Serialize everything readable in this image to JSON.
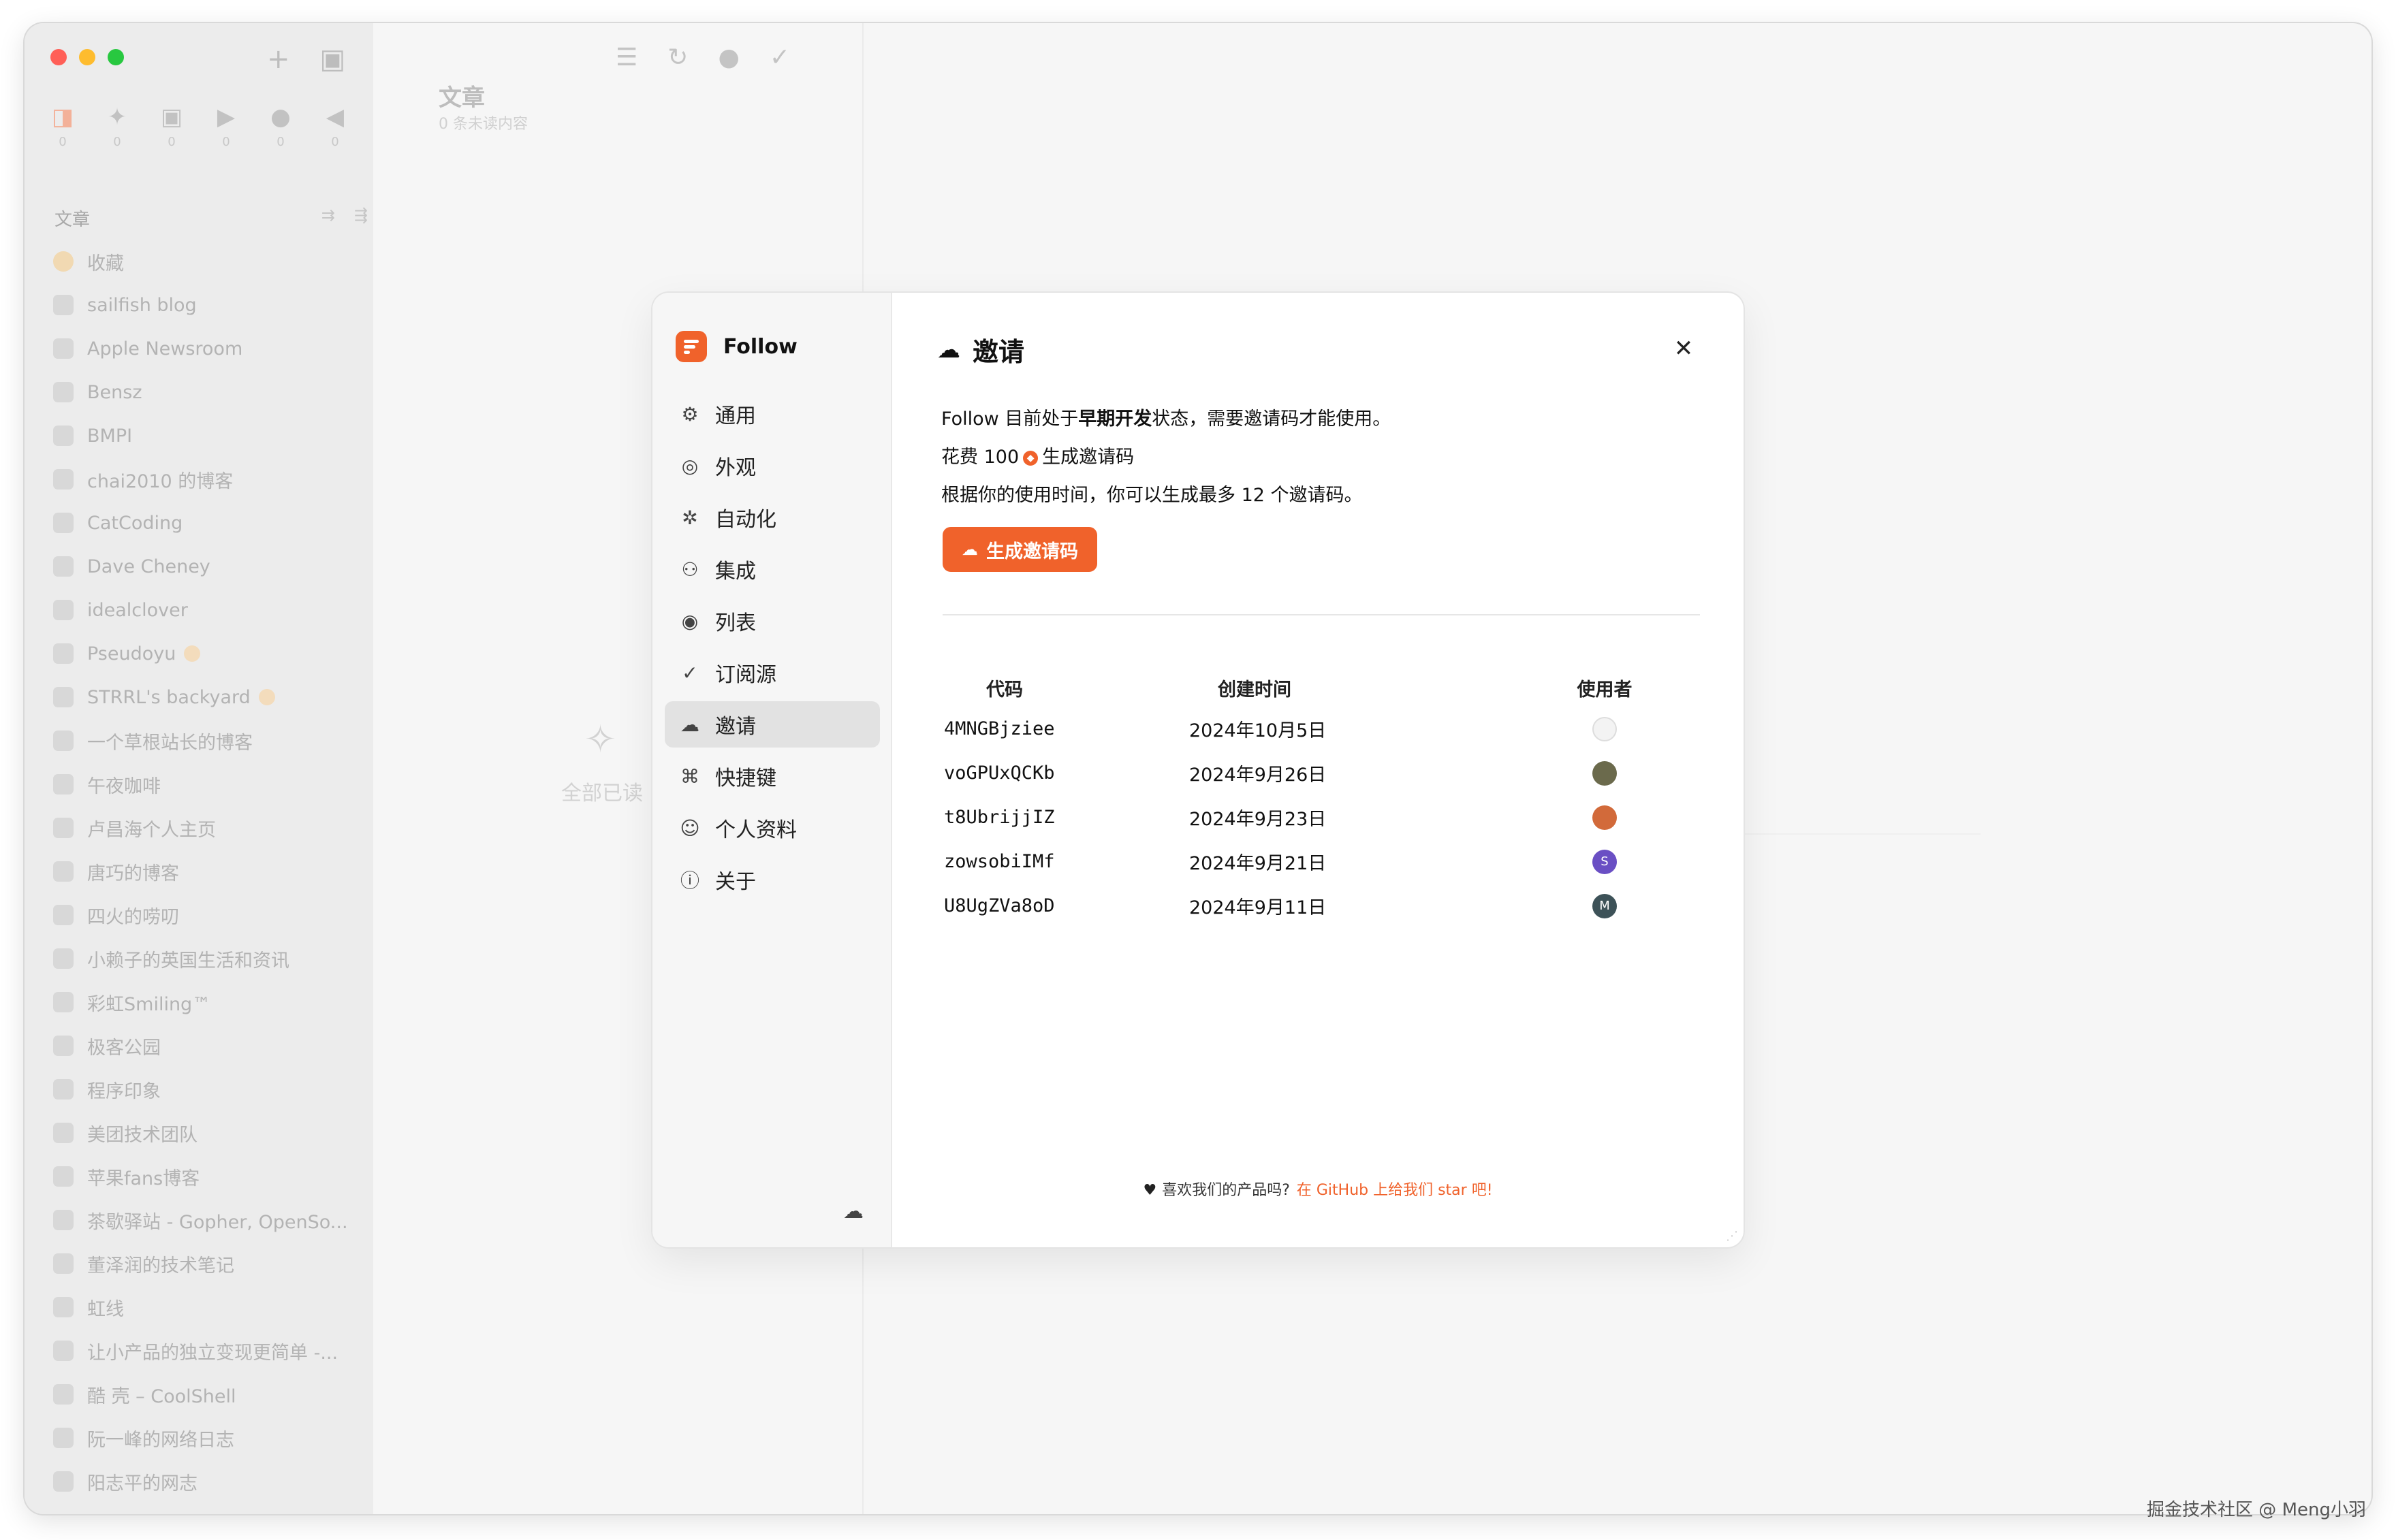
{
  "sidebar": {
    "top_actions": [
      "+",
      "▣"
    ],
    "icon_counts": [
      "0",
      "0",
      "0",
      "0",
      "0",
      "0"
    ],
    "section_title": "文章",
    "section_actions": [
      "⇉",
      "⇶"
    ],
    "feeds": [
      {
        "label": "收藏",
        "icon": "star"
      },
      {
        "label": "sailfish blog"
      },
      {
        "label": "Apple Newsroom"
      },
      {
        "label": "Bensz"
      },
      {
        "label": "BMPI"
      },
      {
        "label": "chai2010 的博客"
      },
      {
        "label": "CatCoding"
      },
      {
        "label": "Dave Cheney"
      },
      {
        "label": "idealclover"
      },
      {
        "label": "Pseudoyu",
        "badge": true
      },
      {
        "label": "STRRL's backyard",
        "badge": true
      },
      {
        "label": "一个草根站长的博客"
      },
      {
        "label": "午夜咖啡"
      },
      {
        "label": "卢昌海个人主页"
      },
      {
        "label": "唐巧的博客"
      },
      {
        "label": "四火的唠叨"
      },
      {
        "label": "小赖子的英国生活和资讯"
      },
      {
        "label": "彩虹Smiling™"
      },
      {
        "label": "极客公园"
      },
      {
        "label": "程序印象"
      },
      {
        "label": "美团技术团队"
      },
      {
        "label": "苹果fans博客"
      },
      {
        "label": "茶歇驿站 - Gopher, OpenSo..."
      },
      {
        "label": "董泽润的技术笔记"
      },
      {
        "label": "虹线"
      },
      {
        "label": "让小产品的独立变现更简单 -..."
      },
      {
        "label": "酷 壳 – CoolShell"
      },
      {
        "label": "阮一峰的网络日志"
      },
      {
        "label": "阳志平的网志"
      }
    ]
  },
  "middle": {
    "title": "文章",
    "subtitle": "0 条未读内容",
    "empty_text": "全部已读"
  },
  "modal": {
    "brand": "Follow",
    "nav": [
      {
        "label": "通用",
        "icon": "⚙"
      },
      {
        "label": "外观",
        "icon": "◎"
      },
      {
        "label": "自动化",
        "icon": "✲"
      },
      {
        "label": "集成",
        "icon": "⚇"
      },
      {
        "label": "列表",
        "icon": "◉"
      },
      {
        "label": "订阅源",
        "icon": "✓"
      },
      {
        "label": "邀请",
        "icon": "☁",
        "active": true
      },
      {
        "label": "快捷键",
        "icon": "⌘"
      },
      {
        "label": "个人资料",
        "icon": "☺"
      },
      {
        "label": "关于",
        "icon": "ⓘ"
      }
    ],
    "title": "邀请",
    "desc": {
      "line1_prefix": "Follow 目前处于",
      "line1_bold": "早期开发",
      "line1_suffix": "状态，需要邀请码才能使用。",
      "line2_prefix": "花费 100",
      "line2_suffix": "生成邀请码",
      "line3": "根据你的使用时间，你可以生成最多 12 个邀请码。"
    },
    "generate_button": "生成邀请码",
    "table": {
      "headers": {
        "code": "代码",
        "created": "创建时间",
        "user": "使用者"
      },
      "rows": [
        {
          "code": "4MNGBjziee",
          "created": "2024年10月5日",
          "avatar_bg": "#f3f3f3",
          "avatar_text": "",
          "avatar_color": "#999999"
        },
        {
          "code": "voGPUxQCKb",
          "created": "2024年9月26日",
          "avatar_bg": "#6b6a4c",
          "avatar_text": "",
          "avatar_color": "#ffffff"
        },
        {
          "code": "t8UbrijjIZ",
          "created": "2024年9月23日",
          "avatar_bg": "#d26a3a",
          "avatar_text": "",
          "avatar_color": "#ffffff"
        },
        {
          "code": "zowsobiIMf",
          "created": "2024年9月21日",
          "avatar_bg": "#6a4fc4",
          "avatar_text": "S",
          "avatar_color": "#ffffff"
        },
        {
          "code": "U8UgZVa8oD",
          "created": "2024年9月11日",
          "avatar_bg": "#3d5258",
          "avatar_text": "M",
          "avatar_color": "#ffffff"
        }
      ]
    },
    "footer_text": "喜欢我们的产品吗?",
    "footer_link": "在 GitHub 上给我们 star 吧!"
  },
  "watermark": "掘金技术社区 @ Meng小羽",
  "colors": {
    "accent": "#f0622b"
  }
}
